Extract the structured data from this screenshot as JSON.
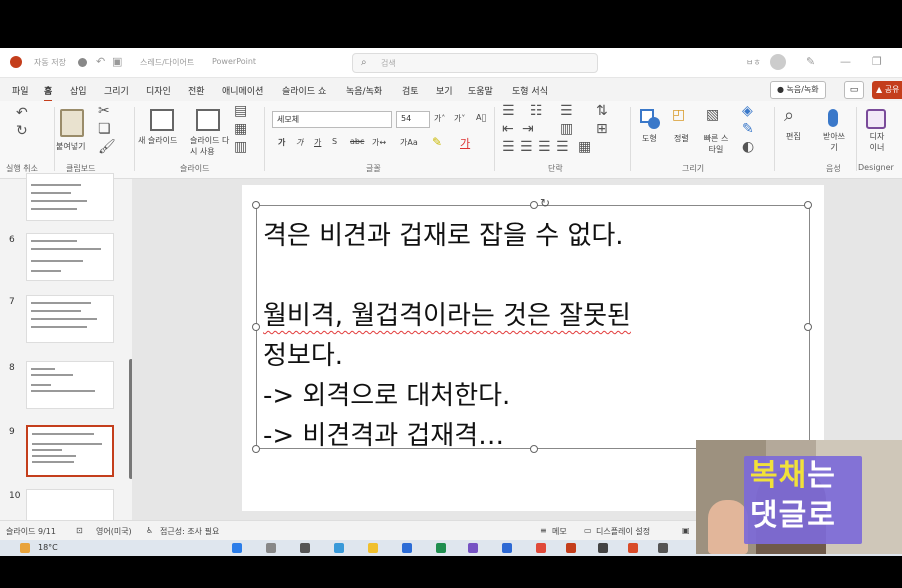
{
  "titlebar": {
    "autosave": "자동 저장",
    "filename": "스레드/다이어트",
    "app_name": "PowerPoint",
    "search_placeholder": "검색",
    "user_initials": "ㅂㅎ"
  },
  "menu": {
    "tabs": [
      "파일",
      "홈",
      "삽입",
      "그리기",
      "디자인",
      "전환",
      "애니메이션",
      "슬라이드 쇼",
      "녹음/녹화",
      "검토",
      "보기",
      "도움말",
      "도형 서식"
    ],
    "active_tab": "홈",
    "record_button": "● 녹음/녹화",
    "share_button": "▲ 공유"
  },
  "ribbon": {
    "undo_group": "실행 취소",
    "paste_label": "붙여넣기",
    "clipboard_group": "클립보드",
    "new_slide_label": "새 슬라이드",
    "reuse_slide_label": "슬라이드 다시 사용",
    "slides_group": "슬라이드",
    "font_name": "세모체",
    "font_size": "54",
    "font_group": "글꼴",
    "paragraph_group": "단락",
    "shape_label": "도형",
    "arrange_label": "정렬",
    "quick_styles_label": "빠른 스타일",
    "drawing_group": "그리기",
    "edit_label": "편집",
    "dictate_label": "받아쓰기",
    "voice_group": "음성",
    "designer_label": "디자이너",
    "designer_group": "Designer"
  },
  "slides_panel": {
    "items": [
      {
        "number": "6"
      },
      {
        "number": "7"
      },
      {
        "number": "8"
      },
      {
        "number": "9",
        "selected": true
      },
      {
        "number": "10"
      }
    ]
  },
  "slide": {
    "lines": [
      "격은 비견과 겁재로 잡을 수 없다.",
      "",
      "월비격, 월겁격이라는 것은 잘못된",
      "정보다.",
      "-> 외격으로 대처한다.",
      "-> 비견격과 겁재격…"
    ]
  },
  "status": {
    "slide_info": "슬라이드 9/11",
    "language": "영어(미국)",
    "accessibility": "접근성: 조사 필요",
    "notes": "메모",
    "display_settings": "디스플레이 설정"
  },
  "taskbar": {
    "weather": "18°C"
  },
  "overlay": {
    "line1_a": "복",
    "line1_b": "채",
    "line1_c": "는",
    "line2": "댓글로"
  },
  "colors": {
    "accent": "#c43e1c",
    "promo_bg": "#7d6ad8",
    "promo_highlight": "#f1e13a"
  }
}
